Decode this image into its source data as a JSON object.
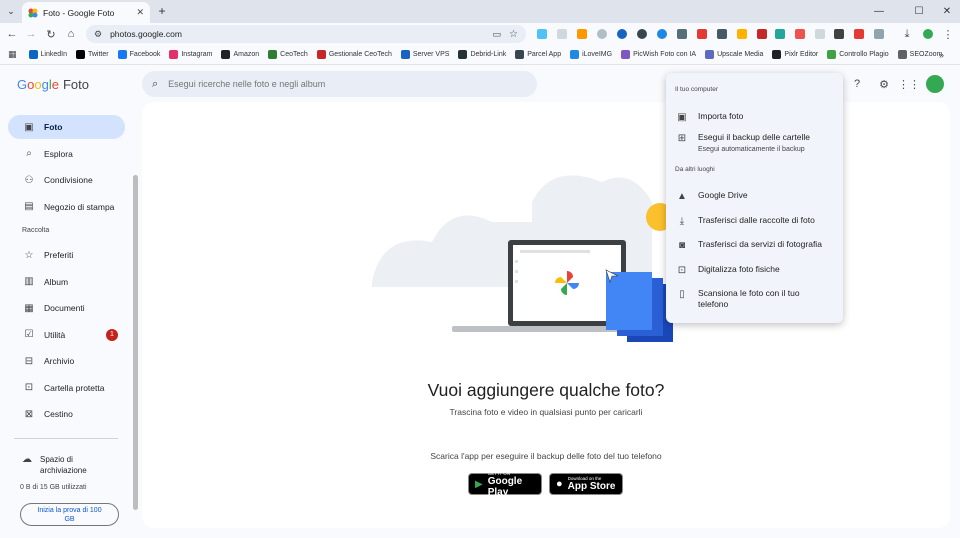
{
  "browser": {
    "tab_title": "Foto - Google Foto",
    "url": "photos.google.com",
    "new_tab_icon": "plus-icon",
    "bookmarks": [
      {
        "label": "LinkedIn",
        "color": "#0a66c2"
      },
      {
        "label": "Twitter",
        "color": "#000000"
      },
      {
        "label": "Facebook",
        "color": "#1877f2"
      },
      {
        "label": "Instagram",
        "color": "#e1306c"
      },
      {
        "label": "Amazon",
        "color": "#222222"
      },
      {
        "label": "CeoTech",
        "color": "#2e7d32"
      },
      {
        "label": "Gestionale CeoTech",
        "color": "#c62828"
      },
      {
        "label": "Server VPS",
        "color": "#1565c0"
      },
      {
        "label": "Debrid-Link",
        "color": "#263238"
      },
      {
        "label": "Parcel App",
        "color": "#37474f"
      },
      {
        "label": "iLoveIMG",
        "color": "#1e88e5"
      },
      {
        "label": "PicWish Foto con IA",
        "color": "#7e57c2"
      },
      {
        "label": "Upscale Media",
        "color": "#5c6bc0"
      },
      {
        "label": "Pixlr Editor",
        "color": "#212121"
      },
      {
        "label": "Controllo Plagio",
        "color": "#43a047"
      },
      {
        "label": "SEOZoom",
        "color": "#616161"
      }
    ]
  },
  "app": {
    "logo_google": "Google",
    "logo_product": "Foto",
    "search_placeholder": "Esegui ricerche nelle foto e negli album",
    "colors": {
      "accent": "#0b57d0",
      "active_nav": "#d3e3fd",
      "badge": "#c5221f"
    }
  },
  "sidebar": {
    "items": [
      {
        "label": "Foto",
        "icon": "photo-icon",
        "active": true
      },
      {
        "label": "Esplora",
        "icon": "search-icon",
        "active": false
      },
      {
        "label": "Condivisione",
        "icon": "people-icon",
        "active": false
      },
      {
        "label": "Negozio di stampa",
        "icon": "print-shop-icon",
        "active": false
      }
    ],
    "section_label": "Raccolta",
    "collection": [
      {
        "label": "Preferiti",
        "icon": "star-icon"
      },
      {
        "label": "Album",
        "icon": "album-icon"
      },
      {
        "label": "Documenti",
        "icon": "document-icon"
      },
      {
        "label": "Utilità",
        "icon": "utility-icon",
        "badge": "1"
      },
      {
        "label": "Archivio",
        "icon": "archive-icon"
      },
      {
        "label": "Cartella protetta",
        "icon": "lock-folder-icon"
      },
      {
        "label": "Cestino",
        "icon": "trash-icon"
      }
    ],
    "storage_label": "Spazio di archiviazione",
    "storage_usage": "0 B di 15 GB utilizzati",
    "trial_button": "Inizia la prova di 100 GB"
  },
  "main": {
    "headline": "Vuoi aggiungere qualche foto?",
    "subline": "Trascina foto e video in qualsiasi punto per caricarli",
    "app_line": "Scarica l'app per eseguire il backup delle foto del tuo telefono",
    "google_play_small": "GET IT ON",
    "google_play_big": "Google Play",
    "app_store_small": "Download on the",
    "app_store_big": "App Store"
  },
  "menu": {
    "section1": "Il tuo computer",
    "items1": [
      {
        "label": "Importa foto",
        "icon": "import-photo-icon"
      },
      {
        "label": "Esegui il backup delle cartelle",
        "sub": "Esegui automaticamente il backup",
        "icon": "folder-backup-icon"
      }
    ],
    "section2": "Da altri luoghi",
    "items2": [
      {
        "label": "Google Drive",
        "icon": "drive-icon"
      },
      {
        "label": "Trasferisci dalle raccolte di foto",
        "icon": "download-icon"
      },
      {
        "label": "Trasferisci da servizi di fotografia",
        "icon": "camera-transfer-icon"
      },
      {
        "label": "Digitalizza foto fisiche",
        "icon": "scan-photo-icon"
      },
      {
        "label": "Scansiona le foto con il tuo telefono",
        "icon": "phone-icon"
      }
    ]
  }
}
